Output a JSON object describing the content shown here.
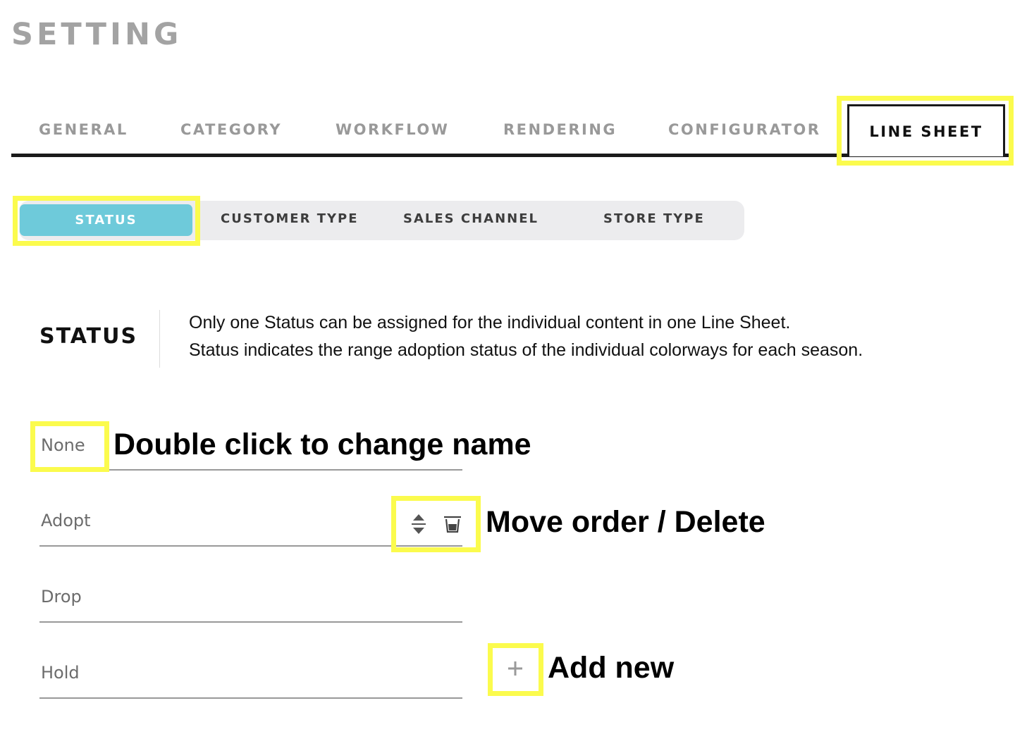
{
  "page": {
    "title": "SETTING"
  },
  "tabs": [
    {
      "label": "GENERAL"
    },
    {
      "label": "CATEGORY"
    },
    {
      "label": "WORKFLOW"
    },
    {
      "label": "RENDERING"
    },
    {
      "label": "CONFIGURATOR"
    },
    {
      "label": "LINE SHEET",
      "active": true
    }
  ],
  "subtabs": [
    {
      "label": "STATUS",
      "active": true
    },
    {
      "label": "CUSTOMER TYPE"
    },
    {
      "label": "SALES CHANNEL"
    },
    {
      "label": "STORE TYPE"
    }
  ],
  "section": {
    "title": "STATUS",
    "description": [
      "Only one Status can be assigned for the individual content in one Line Sheet.",
      "Status indicates the range adoption status of the individual colorways for each season."
    ]
  },
  "status_items": [
    {
      "label": "None"
    },
    {
      "label": "Adopt"
    },
    {
      "label": "Drop"
    },
    {
      "label": "Hold"
    }
  ],
  "icons": {
    "reorder": "reorder-icon",
    "delete": "trash-icon",
    "add": "plus-icon"
  },
  "annotations": {
    "rename": "Double click to change name",
    "move_delete": "Move order / Delete",
    "add_new": "Add new"
  },
  "colors": {
    "highlight": "#fbfb4d",
    "active_subtab": "#6ecada",
    "tab_active_border": "#1a1a1a",
    "muted_text": "#999999"
  }
}
